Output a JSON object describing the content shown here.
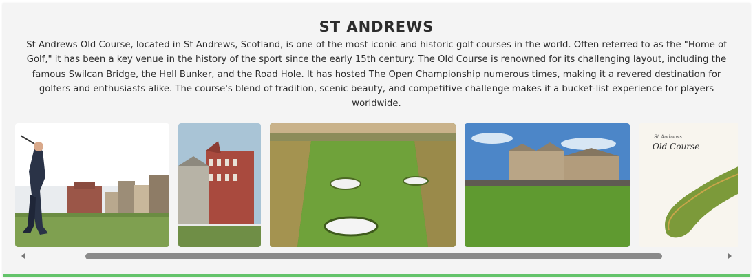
{
  "section": {
    "title": "ST ANDREWS",
    "description": "St Andrews Old Course, located in St Andrews, Scotland, is one of the most iconic and historic golf courses in the world. Often referred to as the \"Home of Golf,\" it has been a key venue in the history of the sport since the early 15th century. The Old Course is renowned for its challenging layout, including the famous Swilcan Bridge, the Hell Bunker, and the Road Hole. It has hosted The Open Championship numerous times, making it a revered destination for golfers and enthusiasts alike. The course's blend of tradition, scenic beauty, and competitive challenge makes it a bucket-list experience for players worldwide."
  },
  "gallery": {
    "map_caption_line1": "St Andrews",
    "map_caption_line2": "Old Course"
  },
  "colors": {
    "accent_border": "#63c36a",
    "title_text": "#2d2d2d",
    "scroll_thumb": "#8a8a8a"
  },
  "icons": [
    "scroll-left-arrow-icon",
    "scroll-right-arrow-icon"
  ]
}
